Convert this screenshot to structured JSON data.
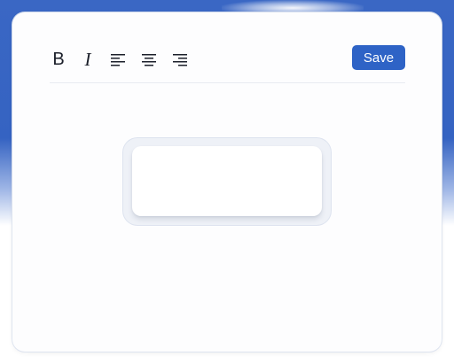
{
  "toolbar": {
    "bold_label": "B",
    "italic_label": "I",
    "align_left_icon": "align-left-icon",
    "align_center_icon": "align-center-icon",
    "align_right_icon": "align-right-icon",
    "save_label": "Save"
  },
  "editor": {
    "text": ""
  },
  "colors": {
    "accent": "#2e63c6",
    "background_top": "#3563c2",
    "card": "#fdfdfe"
  }
}
